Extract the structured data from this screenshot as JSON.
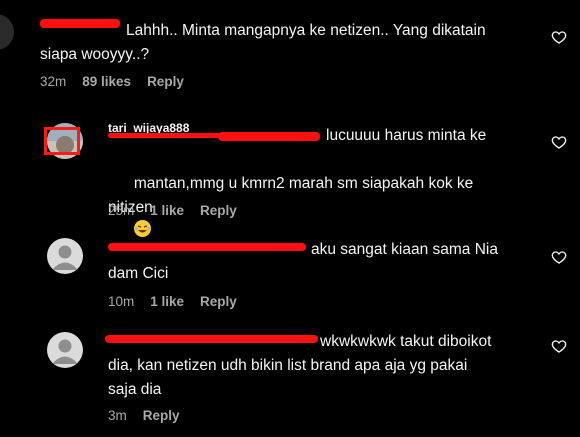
{
  "comments": [
    {
      "text": "Lahhh.. Minta mangapnya ke netizen.. Yang dikatain\nsiapa wooyyy..?",
      "time": "32m",
      "likes": "89 likes",
      "reply": "Reply"
    },
    {
      "username_fragment": "tari_wijaya888",
      "text_line1": "lucuuuu harus minta ke",
      "text_rest": "mantan,mmg u kmrn2 marah sm siapakah kok ke\nnitizen",
      "emoji": "laughing-emoji",
      "time": "25m",
      "likes": "1 like",
      "reply": "Reply"
    },
    {
      "text_line1": "aku sangat kiaan sama Nia",
      "text_rest": "dam Cici",
      "time": "10m",
      "likes": "1 like",
      "reply": "Reply"
    },
    {
      "text_line1": "wkwkwkwk takut diboikot",
      "text_rest": "dia, kan netizen udh bikin list brand apa aja yg pakai\nsaja dia",
      "time": "3m",
      "reply": "Reply"
    }
  ],
  "colors": {
    "background": "#000000",
    "text": "#f5f5f5",
    "meta": "#a8a8a8",
    "redaction": "#ff1010"
  }
}
